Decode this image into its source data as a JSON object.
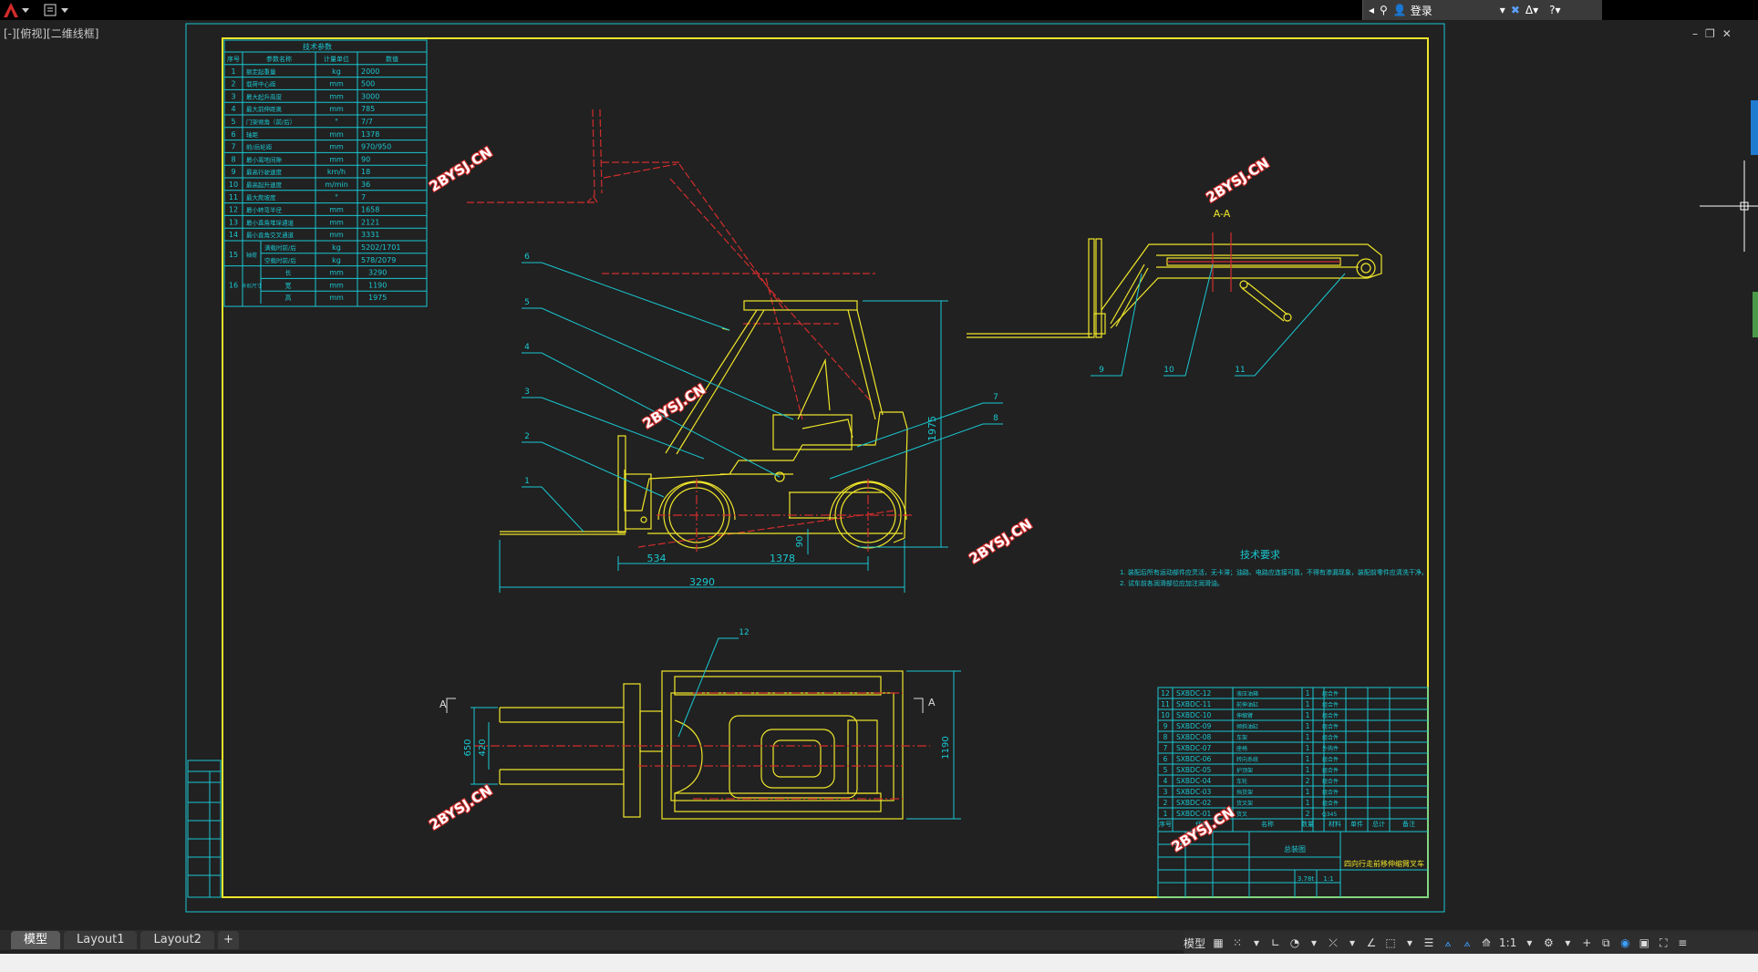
{
  "titlebar": {
    "login_text": "登录",
    "quick_access_icon": "document-icon"
  },
  "viewport": {
    "label": "[-][俯视][二维线框]"
  },
  "window_controls": {
    "minimize": "–",
    "restore": "❐",
    "close": "✕"
  },
  "tabs": [
    "模型",
    "Layout1",
    "Layout2",
    "+"
  ],
  "statusbar": {
    "model_label": "模型",
    "scale_label": "1:1"
  },
  "drawing": {
    "watermark": "2BYSJ.CN",
    "param_table_title": "技术参数",
    "param_table_headers": [
      "序号",
      "参数名称",
      "计量单位",
      "数值"
    ],
    "param_rows": [
      {
        "no": "1",
        "name": "额定起重量",
        "unit": "kg",
        "value": "2000"
      },
      {
        "no": "2",
        "name": "载荷中心距",
        "unit": "mm",
        "value": "500"
      },
      {
        "no": "3",
        "name": "最大起升高度",
        "unit": "mm",
        "value": "3000"
      },
      {
        "no": "4",
        "name": "最大前伸距离",
        "unit": "mm",
        "value": "785"
      },
      {
        "no": "5",
        "name": "门架倾角（前/后）",
        "unit": "°",
        "value": "7/7"
      },
      {
        "no": "6",
        "name": "轴距",
        "unit": "mm",
        "value": "1378"
      },
      {
        "no": "7",
        "name": "前/后轮距",
        "unit": "mm",
        "value": "970/950"
      },
      {
        "no": "8",
        "name": "最小离地间隙",
        "unit": "mm",
        "value": "90"
      },
      {
        "no": "9",
        "name": "最高行驶速度",
        "unit": "km/h",
        "value": "18"
      },
      {
        "no": "10",
        "name": "最高起升速度",
        "unit": "m/min",
        "value": "36"
      },
      {
        "no": "11",
        "name": "最大爬坡度",
        "unit": "°",
        "value": "7"
      },
      {
        "no": "12",
        "name": "最小转弯半径",
        "unit": "mm",
        "value": "1658"
      },
      {
        "no": "13",
        "name": "最小直角堆垛通道",
        "unit": "mm",
        "value": "2121"
      },
      {
        "no": "14",
        "name": "最小直角交叉通道",
        "unit": "mm",
        "value": "3331"
      }
    ],
    "param_row15": {
      "no": "15",
      "group": "轴荷",
      "a_name": "满载时前/后",
      "a_unit": "kg",
      "a_value": "5202/1701",
      "b_name": "空载时前/后",
      "b_unit": "kg",
      "b_value": "578/2079"
    },
    "param_row16": {
      "no": "16",
      "group": "外形尺寸",
      "l_name": "长",
      "l_unit": "mm",
      "l_value": "3290",
      "w_name": "宽",
      "w_unit": "mm",
      "w_value": "1190",
      "h_name": "高",
      "h_unit": "mm",
      "h_value": "1975"
    },
    "dims": {
      "d534": "534",
      "d1378": "1378",
      "d3290": "3290",
      "d1975": "1975",
      "d90": "90",
      "d650": "650",
      "d420": "420",
      "d1190": "1190"
    },
    "callouts": [
      "1",
      "2",
      "3",
      "4",
      "5",
      "6",
      "7",
      "8",
      "9",
      "10",
      "11",
      "12"
    ],
    "section_label": "A-A",
    "view_a": "A",
    "tech_title": "技术要求",
    "tech_lines": [
      "1. 装配后所有运动部件应灵活，无卡滞；油路、电路应连接可靠，不得有渗漏现象，装配前零件应清洗干净。",
      "2. 试车前各润滑部位应加注润滑油。"
    ],
    "bom_rows": [
      {
        "no": "12",
        "code": "SXBDC-12",
        "name": "液压油箱",
        "qty": "1",
        "mat": "组合件"
      },
      {
        "no": "11",
        "code": "SXBDC-11",
        "name": "前伸油缸",
        "qty": "1",
        "mat": "组合件"
      },
      {
        "no": "10",
        "code": "SXBDC-10",
        "name": "伸缩臂",
        "qty": "1",
        "mat": "组合件"
      },
      {
        "no": "9",
        "code": "SXBDC-09",
        "name": "倾斜油缸",
        "qty": "1",
        "mat": "组合件"
      },
      {
        "no": "8",
        "code": "SXBDC-08",
        "name": "车架",
        "qty": "1",
        "mat": "组合件"
      },
      {
        "no": "7",
        "code": "SXBDC-07",
        "name": "座椅",
        "qty": "1",
        "mat": "外购件"
      },
      {
        "no": "6",
        "code": "SXBDC-06",
        "name": "转向系统",
        "qty": "1",
        "mat": "组合件"
      },
      {
        "no": "5",
        "code": "SXBDC-05",
        "name": "护顶架",
        "qty": "1",
        "mat": "组合件"
      },
      {
        "no": "4",
        "code": "SXBDC-04",
        "name": "车轮",
        "qty": "2",
        "mat": "组合件"
      },
      {
        "no": "3",
        "code": "SXBDC-03",
        "name": "挡货架",
        "qty": "1",
        "mat": "组合件"
      },
      {
        "no": "2",
        "code": "SXBDC-02",
        "name": "货叉架",
        "qty": "1",
        "mat": "组合件"
      },
      {
        "no": "1",
        "code": "SXBDC-01",
        "name": "货叉",
        "qty": "2",
        "mat": "Q345"
      }
    ],
    "bom_header": [
      "序号",
      "代号",
      "名称",
      "数量",
      "材料",
      "单件",
      "总计",
      "备注"
    ],
    "title_block": {
      "drawing_name": "四向行走前移伸缩臂叉车",
      "assembly": "总装图",
      "scale": "1:1",
      "ratio": "3.78t"
    }
  }
}
